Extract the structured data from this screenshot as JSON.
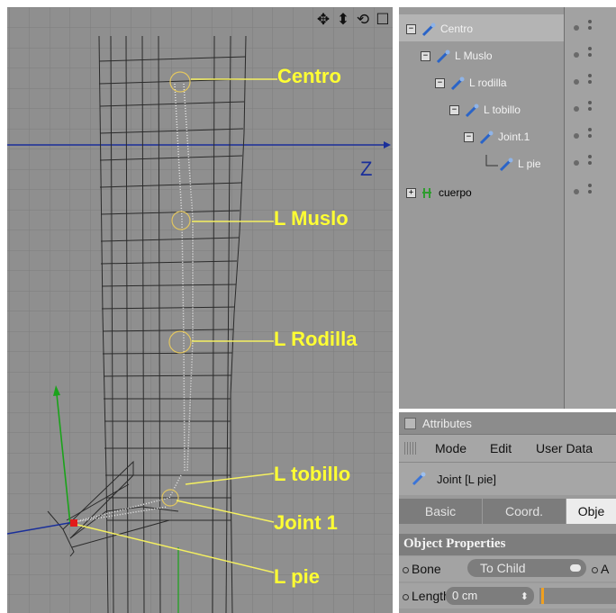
{
  "viewport": {
    "axis_label": "Z",
    "nav_icons": [
      "move-icon",
      "zoom-icon",
      "rotate-icon",
      "maximize-icon"
    ],
    "annotations": [
      {
        "id": "centro",
        "text": "Centro"
      },
      {
        "id": "muslo",
        "text": "L Muslo"
      },
      {
        "id": "rodilla",
        "text": "L Rodilla"
      },
      {
        "id": "tobillo",
        "text": "L tobillo"
      },
      {
        "id": "joint1",
        "text": "Joint 1"
      },
      {
        "id": "pie",
        "text": "L pie"
      }
    ],
    "label_color": "#ffff33"
  },
  "object_manager": {
    "items": [
      {
        "name": "Centro",
        "type": "joint",
        "selected": true
      },
      {
        "name": "L Muslo",
        "type": "joint",
        "selected": true
      },
      {
        "name": "L rodilla",
        "type": "joint",
        "selected": true
      },
      {
        "name": "L tobillo",
        "type": "joint",
        "selected": true
      },
      {
        "name": "Joint.1",
        "type": "joint",
        "selected": true
      },
      {
        "name": "L pie",
        "type": "joint",
        "selected": true
      },
      {
        "name": "cuerpo",
        "type": "polygon",
        "selected": false
      }
    ]
  },
  "attributes": {
    "title": "Attributes",
    "menu": [
      "Mode",
      "Edit",
      "User Data"
    ],
    "object_title": "Joint [L pie]",
    "tabs": [
      "Basic",
      "Coord.",
      "Obje"
    ],
    "active_tab": "Obje",
    "section": "Object Properties",
    "bone_label": "Bone",
    "bone_value": "To Child",
    "extra_label": "A",
    "length_label": "Length",
    "length_value": "0 cm"
  }
}
